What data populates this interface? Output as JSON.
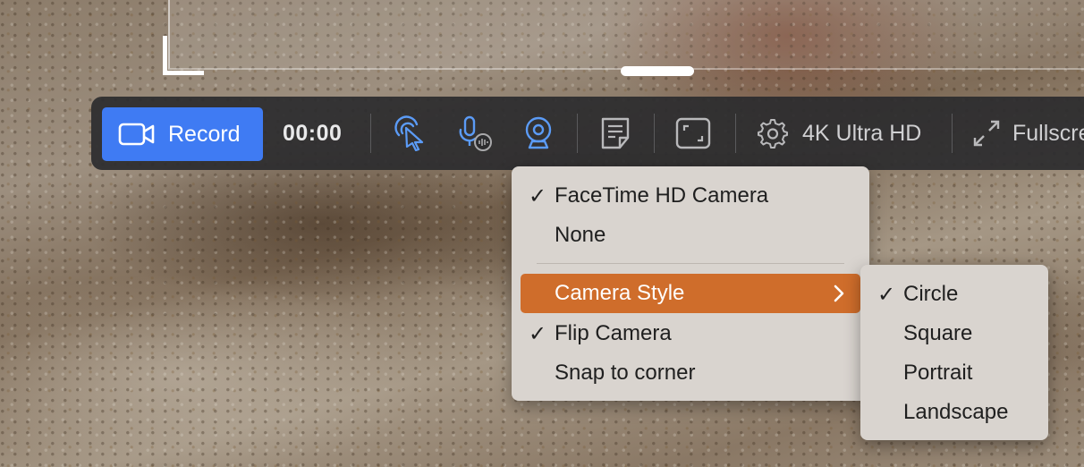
{
  "toolbar": {
    "record_label": "Record",
    "timer": "00:00",
    "resolution_label": "4K Ultra HD",
    "fullscreen_label": "Fullscreen",
    "accent_color": "#3f7bf3",
    "active_icon_color": "#5b9bf6"
  },
  "camera_menu": {
    "items": [
      {
        "label": "FaceTime HD Camera",
        "checked": true
      },
      {
        "label": "None",
        "checked": false
      },
      {
        "label": "Camera Style",
        "checked": false,
        "submenu": true,
        "highlighted": true
      },
      {
        "label": "Flip Camera",
        "checked": true
      },
      {
        "label": "Snap to corner",
        "checked": false
      }
    ],
    "highlight_color": "#cf6d2b"
  },
  "camera_style_menu": {
    "items": [
      {
        "label": "Circle",
        "checked": true
      },
      {
        "label": "Square",
        "checked": false
      },
      {
        "label": "Portrait",
        "checked": false
      },
      {
        "label": "Landscape",
        "checked": false
      }
    ]
  },
  "check_glyph": "✓"
}
